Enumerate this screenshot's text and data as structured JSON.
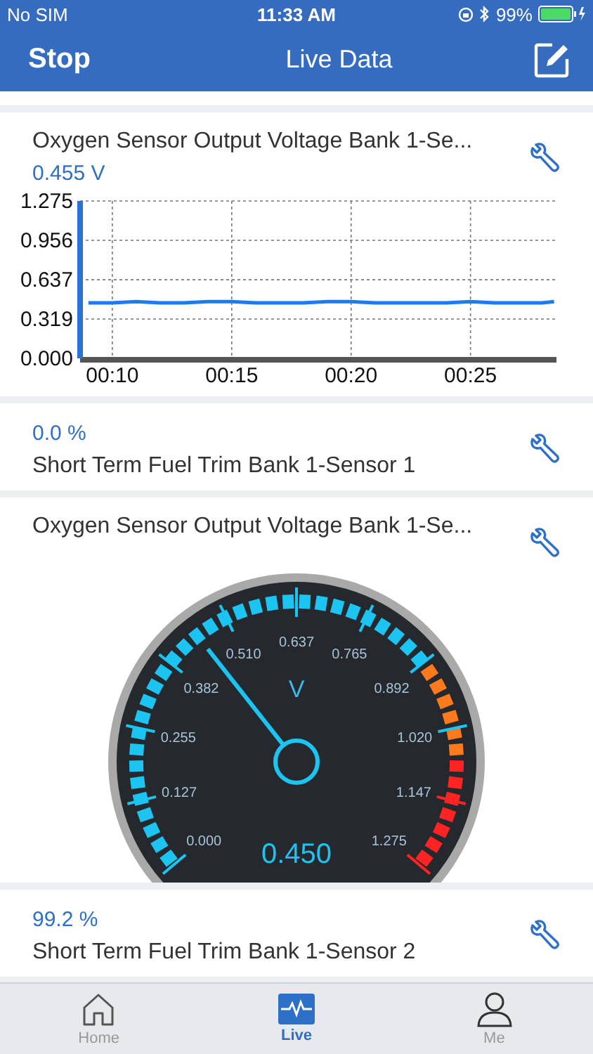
{
  "status_bar": {
    "carrier": "No SIM",
    "time": "11:33 AM",
    "battery": "99%"
  },
  "nav": {
    "left": "Stop",
    "title": "Live Data"
  },
  "cards": [
    {
      "kind": "chart",
      "title": "Oxygen Sensor Output Voltage Bank 1-Se...",
      "value": "0.455 V",
      "chart_data": {
        "type": "line",
        "grid": true,
        "x": [
          9,
          10,
          11,
          12,
          13,
          14,
          15,
          16,
          17,
          18,
          19,
          20,
          21,
          22,
          23,
          24,
          25,
          26,
          27,
          28,
          28.5
        ],
        "series": [
          {
            "color": "#1a7cf0",
            "values": [
              0.45,
              0.45,
              0.46,
              0.45,
              0.45,
              0.46,
              0.46,
              0.45,
              0.45,
              0.45,
              0.46,
              0.46,
              0.45,
              0.45,
              0.45,
              0.45,
              0.46,
              0.45,
              0.45,
              0.45,
              0.46
            ]
          }
        ],
        "xlim": [
          8.65,
          28.6
        ],
        "ylim": [
          0,
          1.275
        ],
        "xticks": [
          {
            "value": 10,
            "label": "00:10"
          },
          {
            "value": 15,
            "label": "00:15"
          },
          {
            "value": 20,
            "label": "00:20"
          },
          {
            "value": 25,
            "label": "00:25"
          }
        ],
        "yticks": [
          {
            "value": 0,
            "label": "0.000"
          },
          {
            "value": 0.319,
            "label": "0.319"
          },
          {
            "value": 0.637,
            "label": "0.637"
          },
          {
            "value": 0.956,
            "label": "0.956"
          },
          {
            "value": 1.275,
            "label": "1.275"
          }
        ]
      }
    },
    {
      "kind": "value",
      "title": "Short Term Fuel Trim Bank 1-Sensor 1",
      "value": "0.0 %"
    },
    {
      "kind": "gauge",
      "title": "Oxygen Sensor Output Voltage Bank 1-Se...",
      "gauge": {
        "unit": "V",
        "reading": "0.450",
        "level": 0.353,
        "ticks": [
          "0.000",
          "0.127",
          "0.255",
          "0.382",
          "0.510",
          "0.637",
          "0.765",
          "0.892",
          "1.020",
          "1.147",
          "1.275"
        ]
      }
    },
    {
      "kind": "value",
      "title": "Short Term Fuel Trim Bank 1-Sensor 2",
      "value": "99.2 %"
    }
  ],
  "tabs": [
    {
      "label": "Home",
      "selected": false
    },
    {
      "label": "Live",
      "selected": true
    },
    {
      "label": "Me",
      "selected": false
    }
  ]
}
